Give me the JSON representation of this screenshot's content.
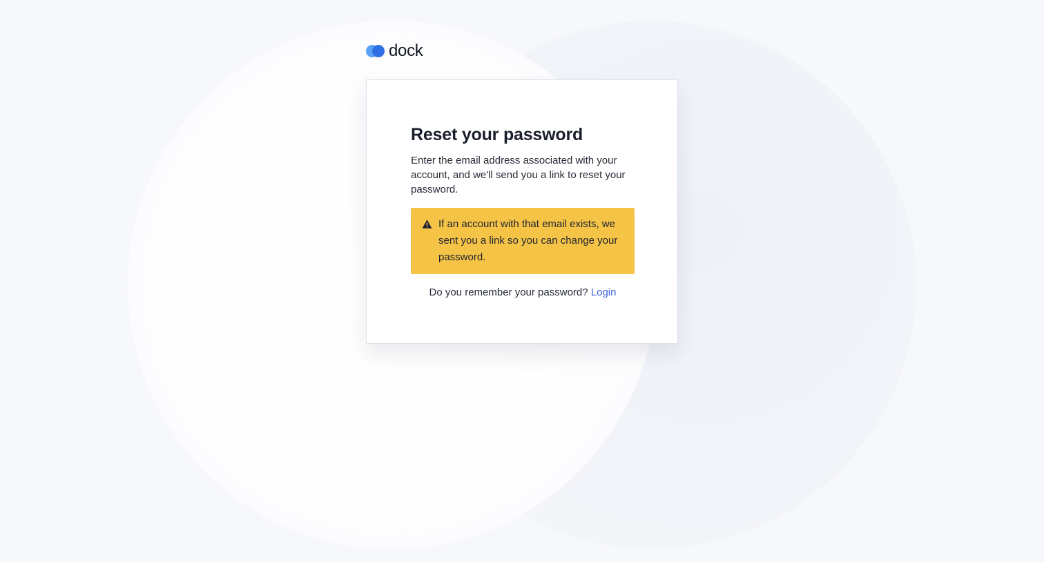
{
  "brand": {
    "name": "dock",
    "colors": {
      "primary": "#2f6fe6",
      "secondary": "#5aa2f5"
    }
  },
  "reset": {
    "title": "Reset your password",
    "description": "Enter the email address associated with your account, and we'll send you a link to reset your password.",
    "alert": {
      "icon": "warning-triangle-icon",
      "text": "If an account with that email exists, we sent you a link so you can change your password.",
      "color": "#f5c346"
    },
    "remember_prompt": "Do you remember your password?",
    "login_link": "Login"
  }
}
